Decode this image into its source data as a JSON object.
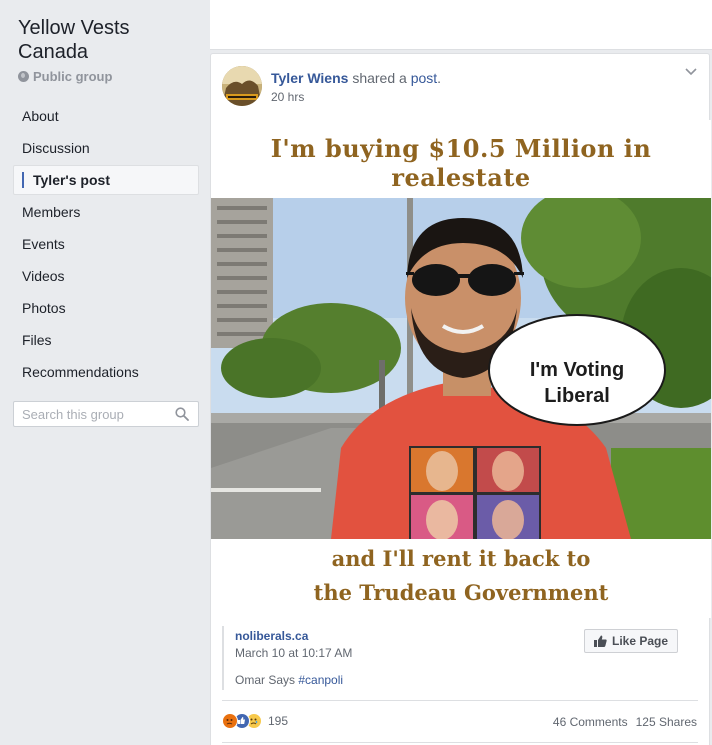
{
  "sidebar": {
    "group_name": "Yellow Vests Canada",
    "group_type": "Public group",
    "nav": [
      {
        "label": "About"
      },
      {
        "label": "Discussion"
      },
      {
        "label": "Tyler's post"
      },
      {
        "label": "Members"
      },
      {
        "label": "Events"
      },
      {
        "label": "Videos"
      },
      {
        "label": "Photos"
      },
      {
        "label": "Files"
      },
      {
        "label": "Recommendations"
      }
    ],
    "active_index": 2,
    "search_placeholder": "Search this group"
  },
  "post": {
    "author": "Tyler Wiens",
    "action": "shared a",
    "object": "post",
    "time": "20 hrs",
    "meme": {
      "top_text": "I'm buying $10.5 Million in realestate",
      "speech_line1": "I'm Voting",
      "speech_line2": "Liberal",
      "bottom_line1": "and I'll rent it back to",
      "bottom_line2": "the Trudeau Government"
    },
    "shared": {
      "source": "noliberals.ca",
      "date": "March 10 at 10:17 AM",
      "desc_prefix": "Omar Says",
      "hashtag": "#canpoli",
      "like_page_label": "Like Page"
    },
    "reactions": {
      "icons": [
        "angry-reaction-icon",
        "like-reaction-icon",
        "sad-reaction-icon"
      ],
      "count": "195"
    },
    "comments": "46 Comments",
    "shares": "125 Shares"
  },
  "colors": {
    "link": "#365899",
    "accent": "#4267b2",
    "meme_text": "#8f6420",
    "background": "#e9ebee"
  }
}
